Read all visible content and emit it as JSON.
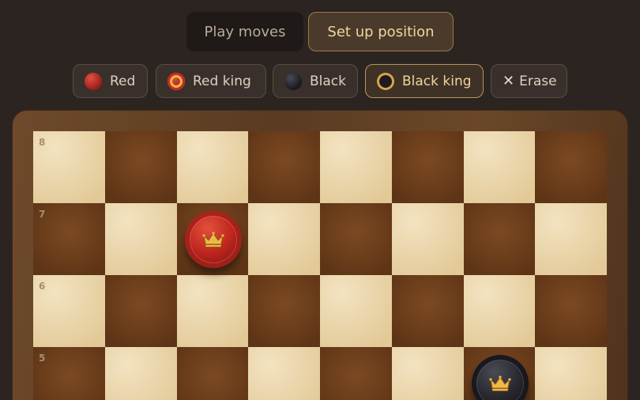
{
  "mode_tabs": [
    {
      "label": "Play moves",
      "active": false
    },
    {
      "label": "Set up position",
      "active": true
    }
  ],
  "tools": {
    "red": {
      "label": "Red",
      "active": false
    },
    "red_king": {
      "label": "Red king",
      "active": false
    },
    "black": {
      "label": "Black",
      "active": false
    },
    "black_king": {
      "label": "Black king",
      "active": true
    },
    "erase": {
      "label": "Erase",
      "icon": "close-icon",
      "active": false
    }
  },
  "board": {
    "rank_labels": [
      "8",
      "7",
      "6",
      "5"
    ],
    "pieces": [
      {
        "square": "c7",
        "color": "red",
        "king": true,
        "icon": "crown-icon"
      },
      {
        "square": "g5",
        "color": "black",
        "king": true,
        "icon": "crown-icon"
      }
    ]
  },
  "colors": {
    "accent": "#b59560",
    "light_square": "#e9d3a8",
    "dark_square": "#6b3c1b",
    "crown": "#f0b84a"
  }
}
